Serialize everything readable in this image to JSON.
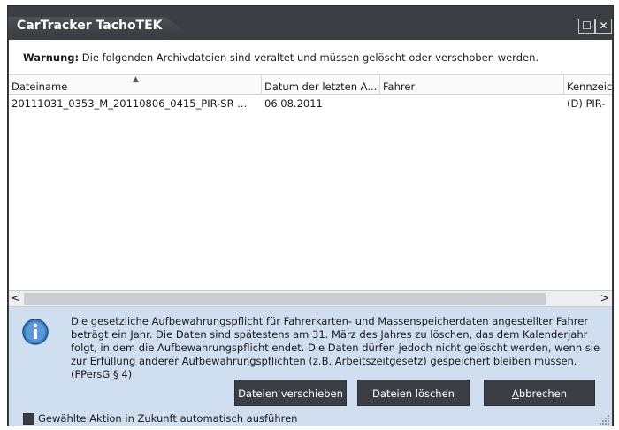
{
  "window": {
    "title": "CarTracker TachoTEK",
    "maximize_glyph": "☐",
    "close_glyph": "✕"
  },
  "warning": {
    "prefix": "Warnung:",
    "text": "Die folgenden Archivdateien sind veraltet und müssen gelöscht oder verschoben werden."
  },
  "table": {
    "columns": [
      "Dateiname",
      "Datum der letzten A...",
      "Fahrer",
      "Kennzeic"
    ],
    "sorted_column_index": 0,
    "rows": [
      {
        "filename": "20111031_0353_M_20110806_0415_PIR-SR ...",
        "date": "06.08.2011",
        "driver": "",
        "plate": "(D) PIR-"
      }
    ]
  },
  "scrollbar": {
    "left_arrow": "<",
    "right_arrow": ">"
  },
  "info": {
    "icon": "info-icon",
    "text": "Die gesetzliche Aufbewahrungspflicht für Fahrerkarten- und Massenspeicherdaten angestellter Fahrer beträgt ein Jahr. Die Daten sind spätestens am 31. März des Jahres zu löschen, das dem Kalenderjahr folgt, in dem die Aufbewahrungspflicht endet. Die Daten dürfen jedoch nicht gelöscht werden, wenn sie zur Erfüllung anderer Aufbewahrungspflichten (z.B. Arbeitszeitgesetz) gespeichert bleiben müssen. (FPersG § 4)"
  },
  "buttons": {
    "move": "Dateien verschieben",
    "delete": "Dateien löschen",
    "cancel_first": "A",
    "cancel_rest": "bbrechen"
  },
  "auto_action": {
    "label": "Gewählte Aktion in Zukunft automatisch ausführen",
    "checked": false
  },
  "colors": {
    "chrome": "#3b3f44",
    "info_background": "#cfdff0",
    "info_icon": "#3f7fc4"
  }
}
